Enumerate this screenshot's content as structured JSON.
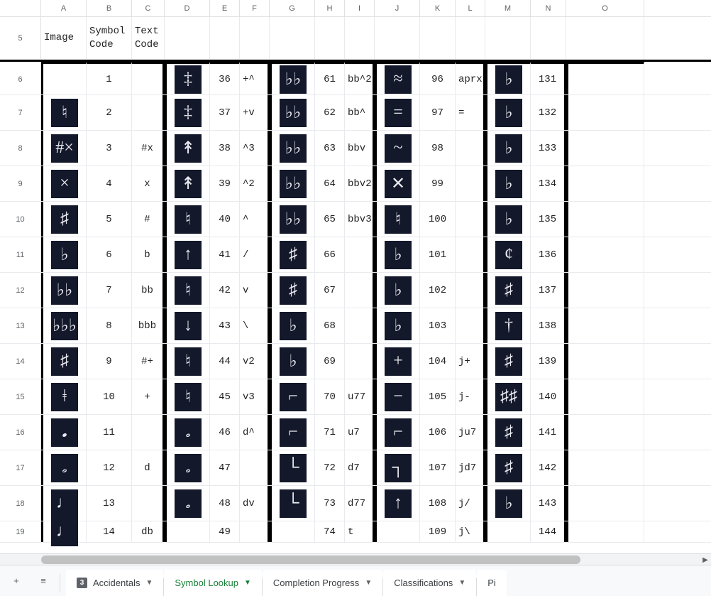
{
  "columns": [
    "A",
    "B",
    "C",
    "D",
    "E",
    "F",
    "G",
    "H",
    "I",
    "J",
    "K",
    "L",
    "M",
    "N",
    "O"
  ],
  "headerRow": {
    "num": "5",
    "A": "Image",
    "B": "Symbol\nCode",
    "C": "Text\nCode"
  },
  "rows": [
    {
      "num": "6",
      "B": "1",
      "C": "",
      "E": "36",
      "F": "+^",
      "H": "61",
      "I": "bb^2",
      "K": "96",
      "L": "aprx",
      "N": "131",
      "symA": "",
      "symD": "‡",
      "symG": "♭♭",
      "symJ": "≈",
      "symM": "♭"
    },
    {
      "num": "7",
      "B": "2",
      "C": "",
      "E": "37",
      "F": "+v",
      "H": "62",
      "I": "bb^",
      "K": "97",
      "L": "=",
      "N": "132",
      "symA": "♮",
      "symD": "‡",
      "symG": "♭♭",
      "symJ": "=",
      "symM": "♭"
    },
    {
      "num": "8",
      "B": "3",
      "C": "#x",
      "E": "38",
      "F": "^3",
      "H": "63",
      "I": "bbv",
      "K": "98",
      "L": "",
      "N": "133",
      "symA": "#×",
      "symD": "↟",
      "symG": "♭♭",
      "symJ": "~",
      "symM": "♭"
    },
    {
      "num": "9",
      "B": "4",
      "C": "x",
      "E": "39",
      "F": "^2",
      "H": "64",
      "I": "bbv2",
      "K": "99",
      "L": "",
      "N": "134",
      "symA": "×",
      "symD": "↟",
      "symG": "♭♭",
      "symJ": "✕",
      "symM": "♭"
    },
    {
      "num": "10",
      "B": "5",
      "C": "#",
      "E": "40",
      "F": "^",
      "H": "65",
      "I": "bbv3",
      "K": "100",
      "L": "",
      "N": "135",
      "symA": "♯",
      "symD": "♮",
      "symG": "♭♭",
      "symJ": "♮",
      "symM": "♭"
    },
    {
      "num": "11",
      "B": "6",
      "C": "b",
      "E": "41",
      "F": "/",
      "H": "66",
      "I": "",
      "K": "101",
      "L": "",
      "N": "136",
      "symA": "♭",
      "symD": "↑",
      "symG": "♯",
      "symJ": "♭",
      "symM": "¢"
    },
    {
      "num": "12",
      "B": "7",
      "C": "bb",
      "E": "42",
      "F": "v",
      "H": "67",
      "I": "",
      "K": "102",
      "L": "",
      "N": "137",
      "symA": "♭♭",
      "symD": "♮",
      "symG": "♯",
      "symJ": "♭",
      "symM": "♯"
    },
    {
      "num": "13",
      "B": "8",
      "C": "bbb",
      "E": "43",
      "F": "\\",
      "H": "68",
      "I": "",
      "K": "103",
      "L": "",
      "N": "138",
      "symA": "♭♭♭",
      "symD": "↓",
      "symG": "♭",
      "symJ": "♭",
      "symM": "†"
    },
    {
      "num": "14",
      "B": "9",
      "C": "#+",
      "E": "44",
      "F": "v2",
      "H": "69",
      "I": "",
      "K": "104",
      "L": "j+",
      "N": "139",
      "symA": "♯",
      "symD": "♮",
      "symG": "♭",
      "symJ": "+",
      "symM": "♯"
    },
    {
      "num": "15",
      "B": "10",
      "C": "+",
      "E": "45",
      "F": "v3",
      "H": "70",
      "I": "u77",
      "K": "105",
      "L": "j-",
      "N": "140",
      "symA": "ǂ",
      "symD": "♮",
      "symG": "⌐",
      "symJ": "−",
      "symM": "♯♯"
    },
    {
      "num": "16",
      "B": "11",
      "C": "",
      "E": "46",
      "F": "d^",
      "H": "71",
      "I": "u7",
      "K": "106",
      "L": "ju7",
      "N": "141",
      "symA": "𝅘",
      "symD": "𝅗",
      "symG": "⌐",
      "symJ": "⌐",
      "symM": "♯"
    },
    {
      "num": "17",
      "B": "12",
      "C": "d",
      "E": "47",
      "F": "",
      "H": "72",
      "I": "d7",
      "K": "107",
      "L": "jd7",
      "N": "142",
      "symA": "𝅗",
      "symD": "𝅗",
      "symG": "└",
      "symJ": "┐",
      "symM": "♯"
    },
    {
      "num": "18",
      "B": "13",
      "C": "",
      "E": "48",
      "F": "dv",
      "H": "73",
      "I": "d77",
      "K": "108",
      "L": "j/",
      "N": "143",
      "symA": "♩",
      "symD": "𝅗",
      "symG": "└",
      "symJ": "↑",
      "symM": "♭"
    },
    {
      "num": "19",
      "B": "14",
      "C": "db",
      "E": "49",
      "F": "",
      "H": "74",
      "I": "t",
      "K": "109",
      "L": "j\\",
      "N": "144",
      "symA": "♩",
      "symD": "",
      "symG": "",
      "symJ": "",
      "symM": "",
      "partial": true
    }
  ],
  "tabs": {
    "add_label": "+",
    "all_sheets_label": "≡",
    "items": [
      {
        "label": "Accidentals",
        "badge": "3",
        "active": false
      },
      {
        "label": "Symbol Lookup",
        "active": true
      },
      {
        "label": "Completion Progress",
        "active": false
      },
      {
        "label": "Classifications",
        "active": false
      },
      {
        "label": "Pi",
        "active": false,
        "cut": true
      }
    ]
  }
}
